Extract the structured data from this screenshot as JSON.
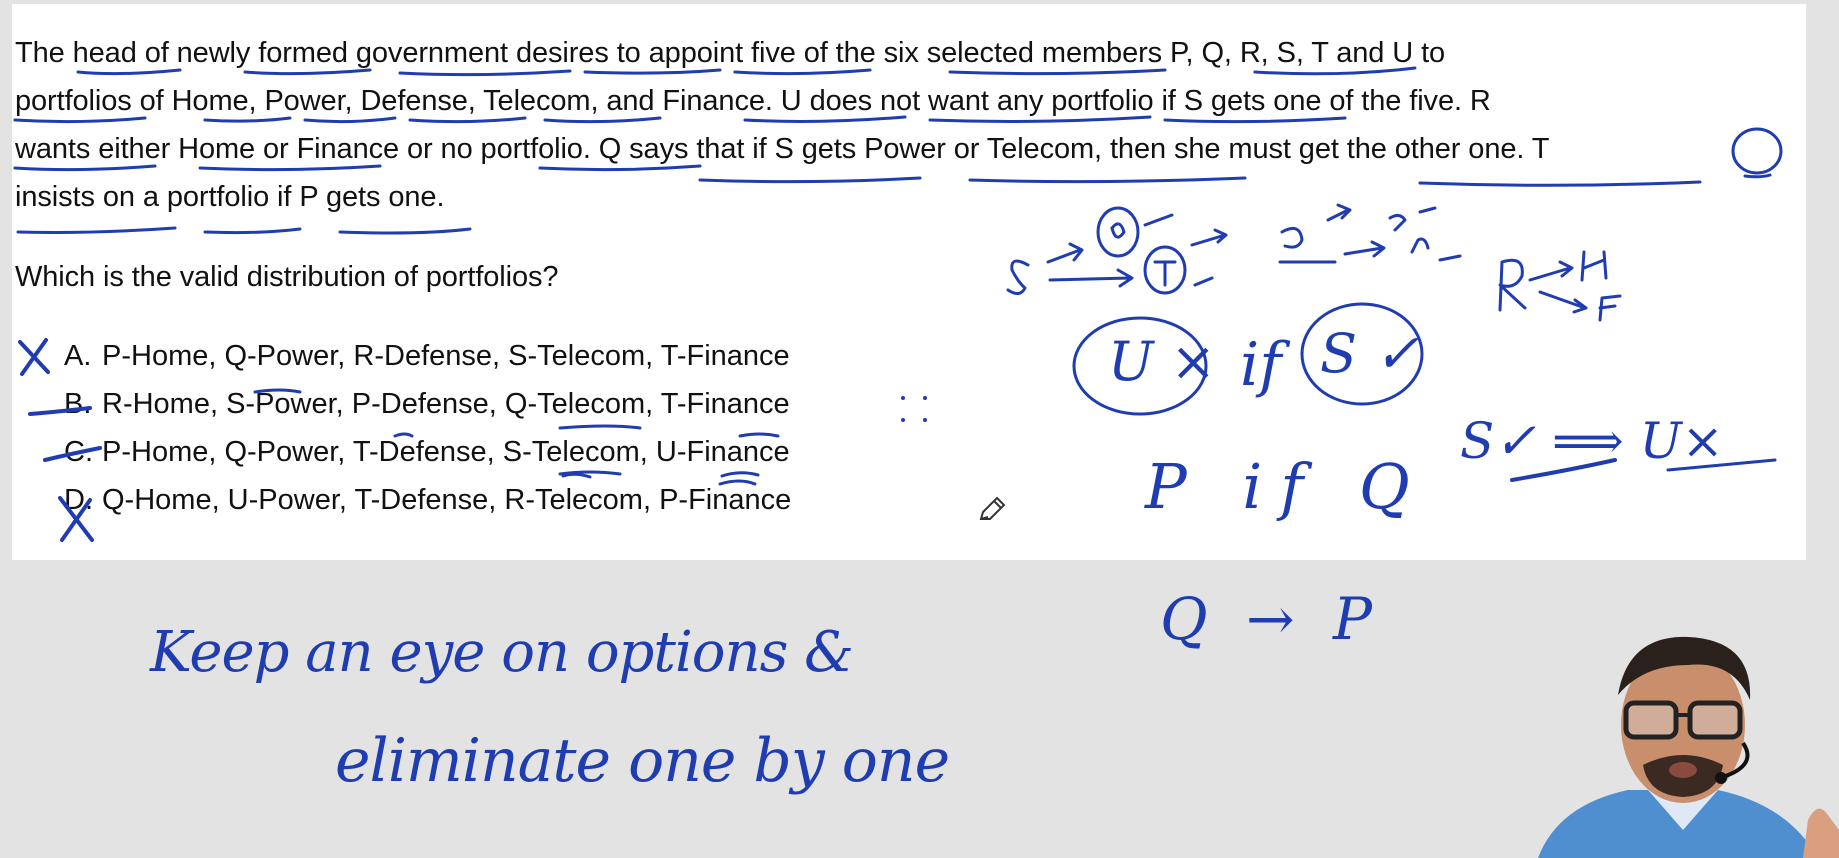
{
  "problem": {
    "line1": "The head of newly formed government desires to appoint five of the six selected members P, Q, R, S, T and U to",
    "line2": "portfolios of Home, Power, Defense, Telecom, and Finance. U does not want any portfolio if S gets one of the five. R",
    "line3": "wants either Home or Finance or no portfolio. Q says that if S gets Power or Telecom, then she must get the other one. T",
    "line4": "insists on a portfolio if P gets one.",
    "question": "Which is the valid distribution of portfolios?"
  },
  "options": [
    {
      "letter": "A.",
      "text": "P-Home, Q-Power, R-Defense, S-Telecom, T-Finance"
    },
    {
      "letter": "B.",
      "text": "R-Home, S-Power, P-Defense, Q-Telecom, T-Finance"
    },
    {
      "letter": "C.",
      "text": "P-Home, Q-Power, T-Defense, S-Telecom, U-Finance"
    },
    {
      "letter": "D.",
      "text": "Q-Home, U-Power, T-Defense, R-Telecom, P-Finance"
    }
  ],
  "annotations": {
    "note_line1": "Keep an eye on options &",
    "note_line2": "eliminate one by one",
    "u_cross": "U ×",
    "if_word": "if",
    "s_tick": "S ✓",
    "s_implies_u": "S✓ ⟹ U×",
    "p_if_q": "P if Q",
    "q_arrow_p": "Q → P",
    "r_home_fin": "R → H / F"
  },
  "theme": {
    "ink_color": "#1f3db0",
    "panel_color": "#ffffff",
    "background": "#e3e3e3"
  }
}
